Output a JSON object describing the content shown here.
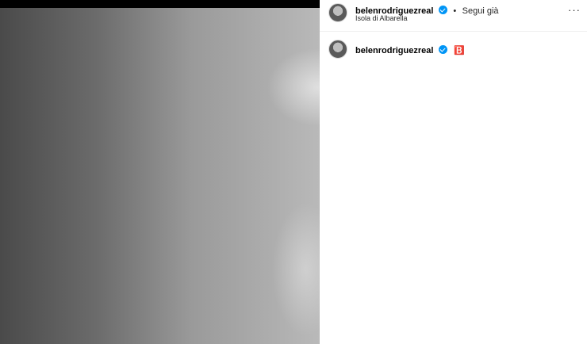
{
  "post": {
    "username": "belenrodriguezreal",
    "follow_status": "Segui già",
    "separator": "•",
    "location": "Isola di Albarella",
    "more_icon": "more-horizontal-icon"
  },
  "caption": {
    "username": "belenrodriguezreal",
    "text": "🅱️"
  },
  "colors": {
    "verified_badge": "#0095f6",
    "divider": "#efefef"
  }
}
